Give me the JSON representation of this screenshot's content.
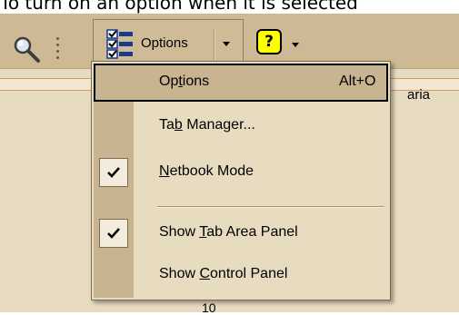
{
  "caption": "To turn on an option when it is selected",
  "toolbar": {
    "options_label": "Options"
  },
  "icons": {
    "search": "search-icon",
    "options": "options-list-icon",
    "help": "help-icon",
    "dropdown": "chevron-down-icon",
    "check": "check-icon"
  },
  "help_glyph": "?",
  "menu": {
    "items": [
      {
        "prefix": "Op",
        "access": "t",
        "suffix": "ions",
        "shortcut": "Alt+O",
        "checked": false,
        "selected": true
      },
      {
        "prefix": "Ta",
        "access": "b",
        "suffix": " Manager...",
        "shortcut": "",
        "checked": false,
        "selected": false
      },
      {
        "prefix": "",
        "access": "N",
        "suffix": "etbook Mode",
        "shortcut": "",
        "checked": true,
        "selected": false
      },
      {
        "prefix": "Show ",
        "access": "T",
        "suffix": "ab Area Panel",
        "shortcut": "",
        "checked": true,
        "selected": false
      },
      {
        "prefix": "Show ",
        "access": "C",
        "suffix": "ontrol Panel",
        "shortcut": "",
        "checked": false,
        "selected": false
      }
    ]
  },
  "background": {
    "side_text": "aria",
    "bottom_text": "10"
  },
  "colors": {
    "toolbar": "#cdb993",
    "menu_bg": "#e7dbc0",
    "menu_gutter": "#c8b490",
    "selection_border": "#000000",
    "help_yellow": "#ffff00"
  }
}
